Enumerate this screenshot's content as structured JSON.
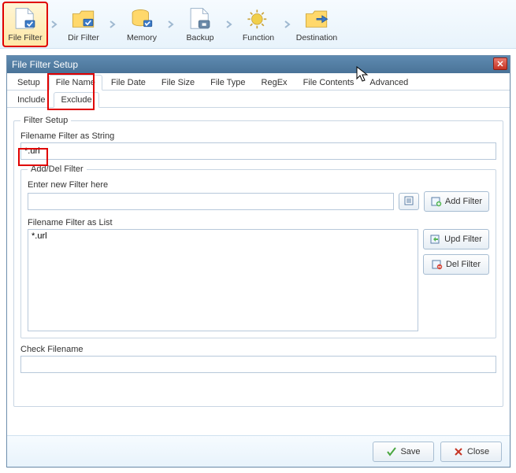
{
  "toolbar": {
    "items": [
      {
        "label": "File Filter"
      },
      {
        "label": "Dir Filter"
      },
      {
        "label": "Memory"
      },
      {
        "label": "Backup"
      },
      {
        "label": "Function"
      },
      {
        "label": "Destination"
      }
    ]
  },
  "window": {
    "title": "File Filter Setup",
    "tabs": [
      "Setup",
      "File Name",
      "File Date",
      "File Size",
      "File Type",
      "RegEx",
      "File Contents",
      "Advanced"
    ],
    "active_tab": "File Name",
    "subtabs": [
      "Include",
      "Exclude"
    ],
    "active_subtab": "Exclude",
    "filter_setup_legend": "Filter Setup",
    "filename_filter_string_label": "Filename Filter as String",
    "filename_filter_string_value": "*.url",
    "add_del_legend": "Add/Del Filter",
    "enter_new_filter_label": "Enter new Filter here",
    "enter_new_filter_value": "",
    "add_filter_btn": "Add Filter",
    "filename_filter_list_label": "Filename Filter as List",
    "filter_list": [
      "*.url"
    ],
    "upd_filter_btn": "Upd Filter",
    "del_filter_btn": "Del Filter",
    "check_filename_label": "Check Filename",
    "check_filename_value": "",
    "save_btn": "Save",
    "close_btn": "Close"
  }
}
